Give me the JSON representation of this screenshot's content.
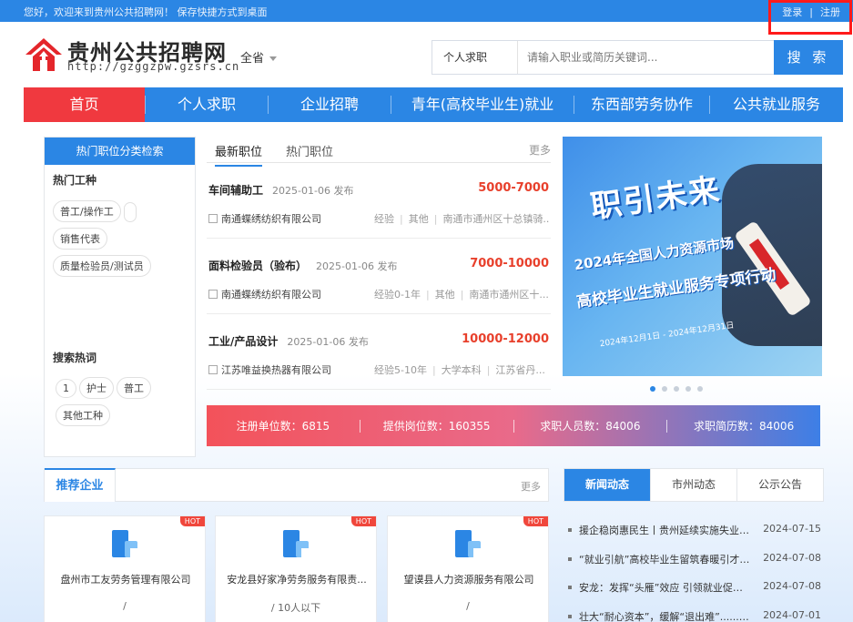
{
  "topbar": {
    "welcome": "您好，欢迎来到贵州公共招聘网！ 保存快捷方式到桌面",
    "login": "登录",
    "divider": "|",
    "register": "注册"
  },
  "brand": {
    "title": "贵州公共招聘网",
    "url": "http://gzggzpw.gzsrs.cn",
    "logo_icon": "house-arrow-logo",
    "accent": "#2b86e4",
    "red": "#f0393f"
  },
  "region": {
    "label": "全省"
  },
  "search": {
    "type": "个人求职",
    "placeholder": "请输入职业或简历关键词...",
    "button": "搜 索"
  },
  "nav": [
    "首页",
    "个人求职",
    "企业招聘",
    "青年(高校毕业生)就业",
    "东西部劳务协作",
    "公共就业服务"
  ],
  "categories": {
    "header": "热门职位分类检索",
    "hot_types_title": "热门工种",
    "hot_types": [
      "普工/操作工",
      "销售代表",
      "质量检验员/测试员"
    ],
    "hot_search_title": "搜索热词",
    "hot_search": [
      "1",
      "护士",
      "普工",
      "其他工种"
    ]
  },
  "jobs": {
    "tabs": [
      "最新职位",
      "热门职位"
    ],
    "more": "更多",
    "items": [
      {
        "title": "车间辅助工",
        "date": "2025-01-06 发布",
        "salary": "5000-7000",
        "company": "南通蝶绣纺织有限公司",
        "meta": [
          "经验",
          "其他",
          "南通市通州区十总镇骑..."
        ]
      },
      {
        "title": "面料检验员（验布）",
        "date": "2025-01-06 发布",
        "salary": "7000-10000",
        "company": "南通蝶绣纺织有限公司",
        "meta": [
          "经验0-1年",
          "其他",
          "南通市通州区十..."
        ]
      },
      {
        "title": "工业/产品设计",
        "date": "2025-01-06 发布",
        "salary": "10000-12000",
        "company": "江苏唯益换热器有限公司",
        "meta": [
          "经验5-10年",
          "大学本科",
          "江苏省丹..."
        ]
      }
    ]
  },
  "banner": {
    "headline": "职引未来",
    "line1": "2024年全国人力资源市场",
    "line2": "高校毕业生就业服务专项行动",
    "note": "2024年12月1日 - 2024年12月31日"
  },
  "stats": [
    "注册单位数：6815",
    "提供岗位数：160355",
    "求职人员数：84006",
    "求职简历数：84006"
  ],
  "enterprises": {
    "title": "推荐企业",
    "more": "更多",
    "hot_label": "HOT",
    "items": [
      {
        "name": "盘州市工友劳务管理有限公司",
        "scale": "/"
      },
      {
        "name": "安龙县好家净劳务服务有限责...",
        "scale": "/ 10人以下"
      },
      {
        "name": "望谟县人力资源服务有限公司",
        "scale": "/"
      }
    ]
  },
  "news": {
    "tabs": [
      "新闻动态",
      "市州动态",
      "公示公告"
    ],
    "items": [
      {
        "text": "援企稳岗惠民生丨贵州延续实施失业保...",
        "date": "2024-07-15"
      },
      {
        "text": "“就业引航”高校毕业生留筑春暖引才行...",
        "date": "2024-07-08"
      },
      {
        "text": "安龙：发挥“头雁”效应 引领就业促增收",
        "date": "2024-07-08"
      },
      {
        "text": "壮大“耐心资本”，缓解“退出难”......四...",
        "date": "2024-07-01"
      }
    ]
  }
}
